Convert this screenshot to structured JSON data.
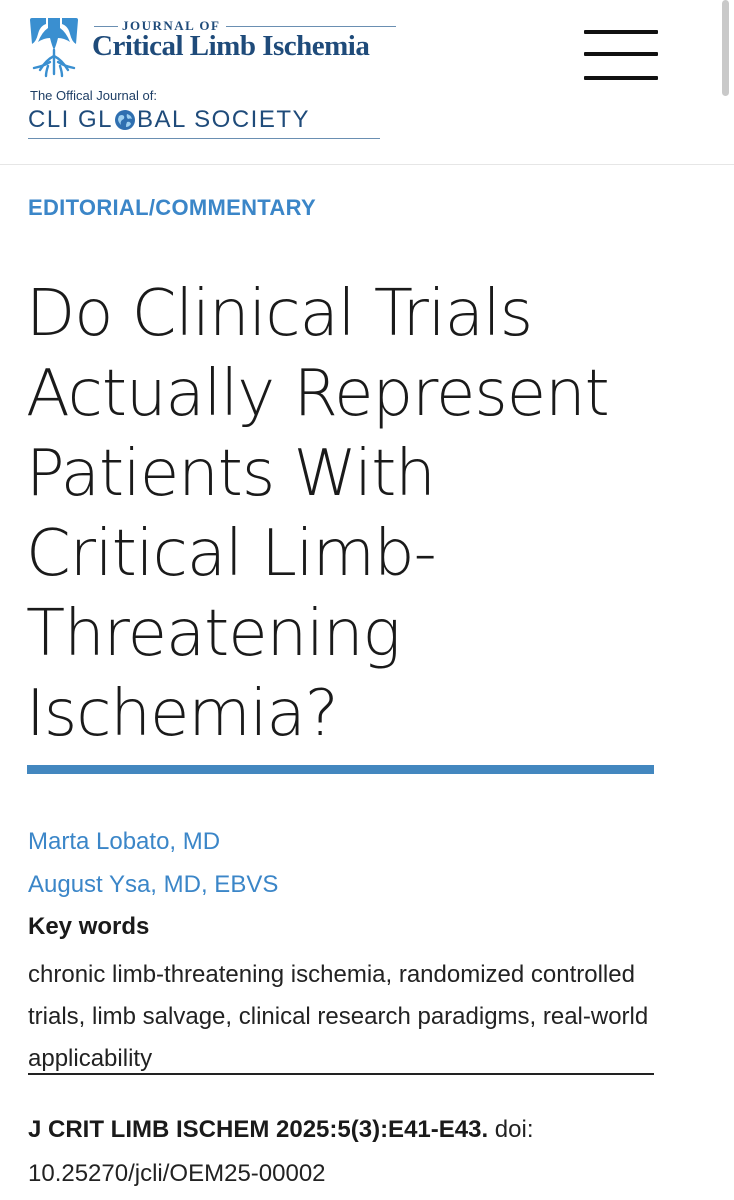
{
  "header": {
    "journal_of": "JOURNAL OF",
    "journal_name": "Critical Limb Ischemia",
    "official_label": "The Offical Journal of:",
    "society_prefix": "CLI GL",
    "society_suffix": "BAL SOCIETY",
    "logo_icon": "tree-roots-icon",
    "globe_icon": "globe-icon",
    "menu_icon": "hamburger-menu-icon",
    "brand_color": "#1f4b7a"
  },
  "article": {
    "section": "EDITORIAL/COMMENTARY",
    "title": "Do Clinical Trials Actually Represent Patients With Critical Limb-Threatening Ischemia?",
    "accent_color": "#3b86c8",
    "authors": [
      "Marta Lobato, MD",
      "August Ysa, MD, EBVS"
    ],
    "keywords_heading": "Key words",
    "keywords": "chronic limb-threatening ischemia, randomized controlled trials, limb salvage, clinical research paradigms, real-world applicability",
    "citation_ref": "J CRIT LIMB ISCHEM 2025:5(3):E41-E43.",
    "citation_doi": " doi: 10.25270/jcli/OEM25-00002"
  }
}
